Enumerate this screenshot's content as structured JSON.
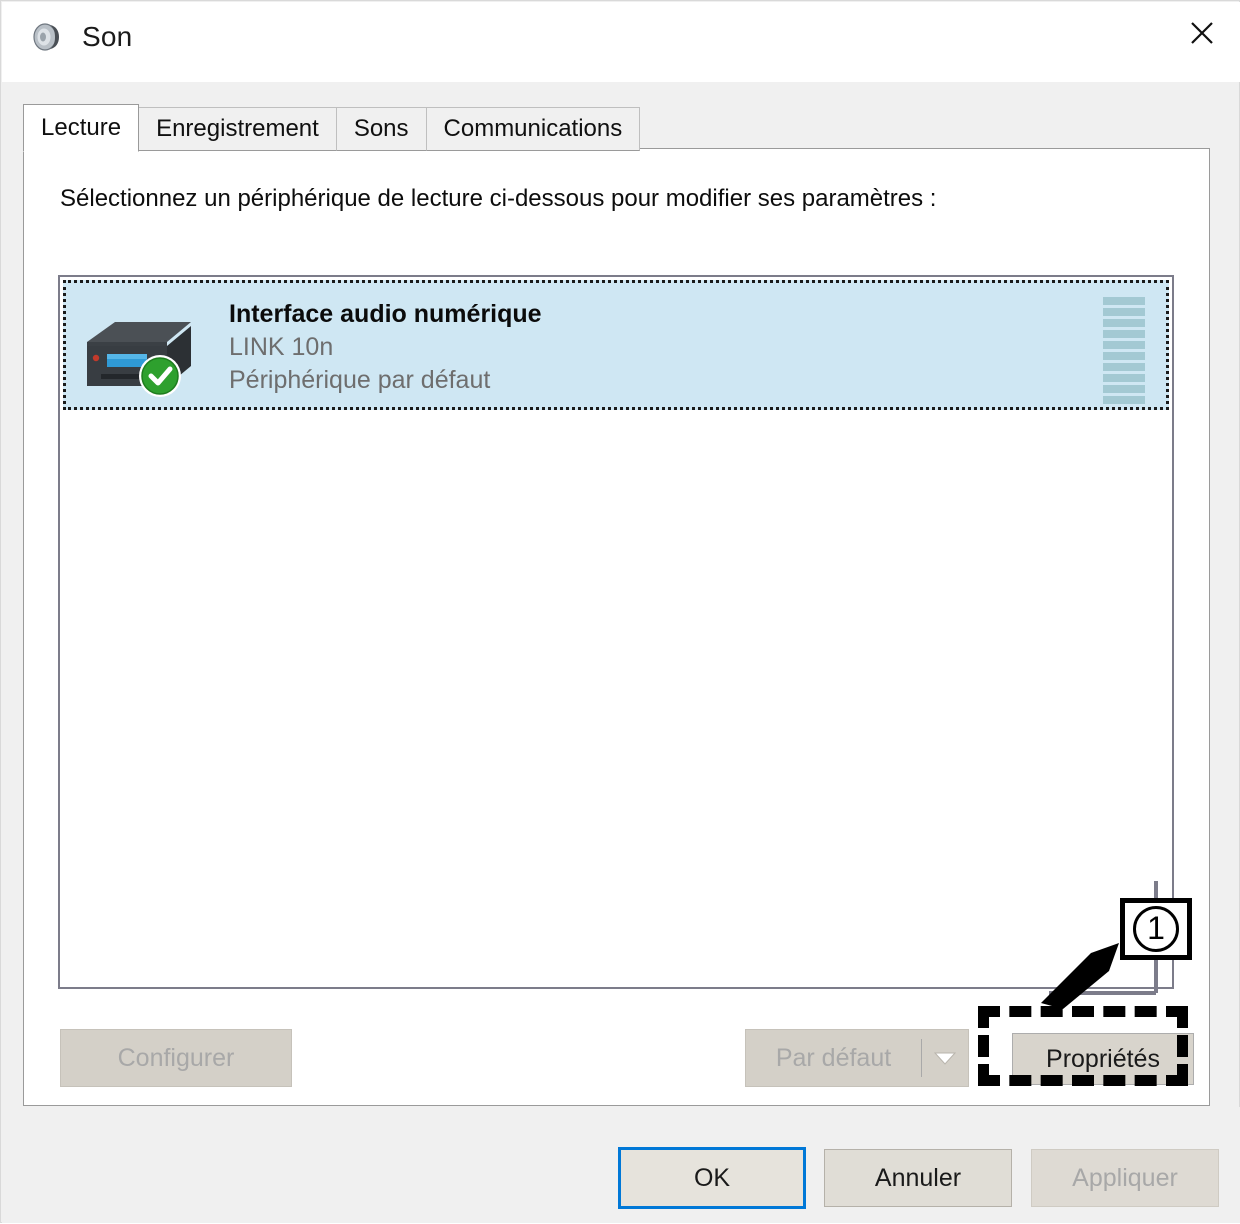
{
  "window": {
    "title": "Son",
    "icon": "speaker-icon",
    "close_icon": "close-icon"
  },
  "tabs": [
    {
      "label": "Lecture",
      "active": true
    },
    {
      "label": "Enregistrement",
      "active": false
    },
    {
      "label": "Sons",
      "active": false
    },
    {
      "label": "Communications",
      "active": false
    }
  ],
  "panel": {
    "instruction": "Sélectionnez un périphérique de lecture ci-dessous pour modifier ses paramètres :"
  },
  "devices": [
    {
      "name": "Interface audio numérique",
      "model": "LINK 10n",
      "status": "Périphérique par défaut",
      "selected": true,
      "badge_icon": "green-check-icon",
      "device_icon": "audio-interface-icon",
      "meter_bars": 10
    }
  ],
  "actions": {
    "configure_label": "Configurer",
    "configure_enabled": false,
    "default_label": "Par défaut",
    "default_enabled": false,
    "default_dropdown_icon": "chevron-down-icon",
    "properties_label": "Propriétés",
    "properties_enabled": true
  },
  "footer": {
    "ok_label": "OK",
    "cancel_label": "Annuler",
    "apply_label": "Appliquer",
    "apply_enabled": false
  },
  "annotation": {
    "step_number": "1",
    "target": "properties-button"
  },
  "colors": {
    "selection_bg": "#CFE7F3",
    "meter_bar": "#A3C9D3",
    "focus_border": "#0078D7",
    "badge_green": "#2EA02E",
    "annotation": "#000000",
    "dialog_bg": "#F0F0F0"
  }
}
